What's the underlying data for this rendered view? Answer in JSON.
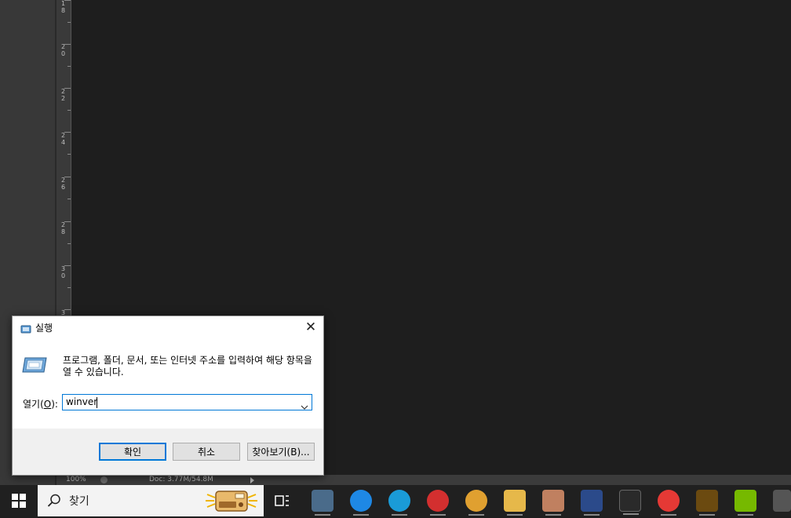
{
  "ruler": {
    "labels": [
      "1\n8",
      "2\n0",
      "2\n2",
      "2\n4",
      "2\n6",
      "2\n8",
      "3\n0",
      "3"
    ]
  },
  "status_bar": {
    "zoom": "100%",
    "doc_info": "Doc: 3.77M/54.8M"
  },
  "run_dialog": {
    "title": "실행",
    "close_glyph": "✕",
    "description": "프로그램, 폴더, 문서, 또는 인터넷 주소를 입력하여 해당 항목을 열 수 있습니다.",
    "open_label": "열기(",
    "open_label_mnemonic": "O",
    "open_label_suffix": "):",
    "open_value": "winver",
    "ok_button": "확인",
    "cancel_button": "취소",
    "browse_button": "찾아보기(B)..."
  },
  "taskbar": {
    "search_text": "찾기",
    "apps": [
      {
        "icon": "app-icon",
        "color": "#4a6b8a"
      },
      {
        "icon": "cloud-icon",
        "color": "#1e88e5"
      },
      {
        "icon": "edge-icon",
        "color": "#1a9bd7"
      },
      {
        "icon": "opera-icon",
        "color": "#d32f2f"
      },
      {
        "icon": "chrome-icon",
        "color": "#e0a030"
      },
      {
        "icon": "folder-icon",
        "color": "#e6b84a"
      },
      {
        "icon": "photo-icon",
        "color": "#c08060"
      },
      {
        "icon": "photoshop-icon",
        "color": "#2b4a8a"
      },
      {
        "icon": "terminal-icon",
        "color": "#2a2a2a"
      },
      {
        "icon": "chrome-icon",
        "color": "#e53935"
      },
      {
        "icon": "illustrator-icon",
        "color": "#6b4a10"
      },
      {
        "icon": "nvidia-icon",
        "color": "#76b900"
      },
      {
        "icon": "app-icon",
        "color": "#555555"
      }
    ]
  }
}
